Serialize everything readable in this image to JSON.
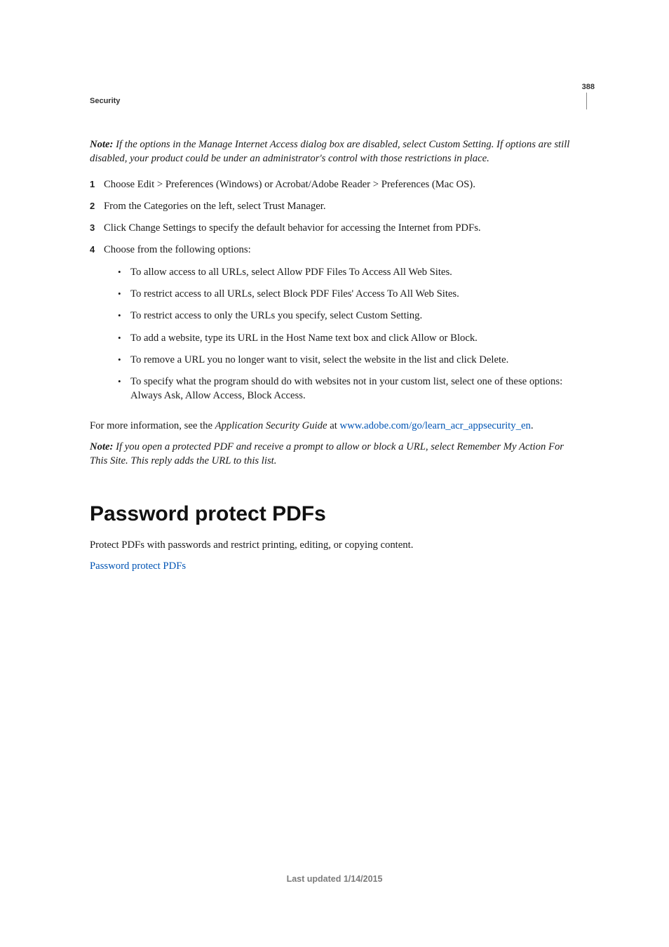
{
  "page_number": "388",
  "section_label": "Security",
  "intro_note": {
    "lead": "Note:",
    "rest": " If the options in the Manage Internet Access dialog box are disabled, select Custom Setting. If options are still disabled, your product could be under an administrator's control with those restrictions in place."
  },
  "steps": [
    {
      "num": "1",
      "text": "Choose Edit > Preferences (Windows) or Acrobat/Adobe Reader > Preferences (Mac OS)."
    },
    {
      "num": "2",
      "text": "From the Categories on the left, select Trust Manager."
    },
    {
      "num": "3",
      "text": "Click Change Settings to specify the default behavior for accessing the Internet from PDFs."
    },
    {
      "num": "4",
      "text": "Choose from the following options:"
    }
  ],
  "options": [
    "To allow access to all URLs, select Allow PDF Files To Access All Web Sites.",
    "To restrict access to all URLs, select Block PDF Files' Access To All Web Sites.",
    "To restrict access to only the URLs you specify, select Custom Setting.",
    "To add a website, type its URL in the Host Name text box and click Allow or Block.",
    "To remove a URL you no longer want to visit, select the website in the list and click Delete.",
    "To specify what the program should do with websites not in your custom list, select one of these options: Always Ask, Allow Access, Block Access."
  ],
  "more_info": {
    "pre": "For more information, see the ",
    "ital": "Application Security Guide",
    "mid": " at ",
    "link": "www.adobe.com/go/learn_acr_appsecurity_en",
    "post": "."
  },
  "closing_note": {
    "lead": "Note:",
    "rest": " If you open a protected PDF and receive a prompt to allow or block a URL, select Remember My Action For This Site. This reply adds the URL to this list."
  },
  "section_title": "Password protect PDFs",
  "section_intro": "Protect PDFs with passwords and restrict printing, editing, or copying content.",
  "section_link": "Password protect PDFs",
  "footer": "Last updated 1/14/2015"
}
